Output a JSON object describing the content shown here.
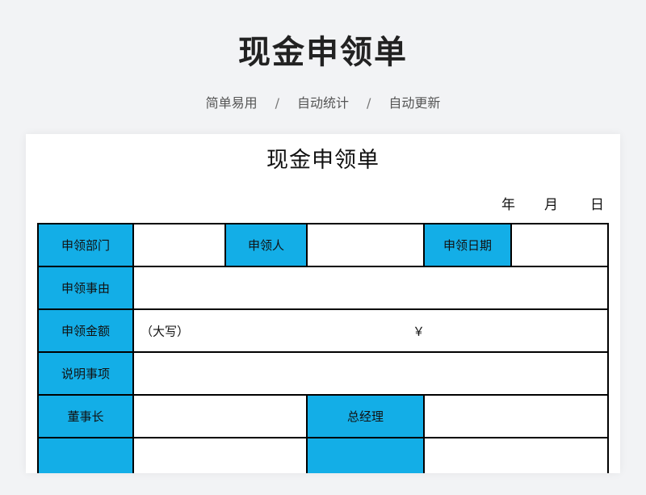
{
  "header": {
    "title": "现金申领单",
    "tags": [
      "简单易用",
      "自动统计",
      "自动更新"
    ],
    "separator": "/"
  },
  "document": {
    "title": "现金申领单",
    "date": {
      "year": "年",
      "month": "月",
      "day": "日"
    },
    "row1": {
      "dept_label": "申领部门",
      "person_label": "申领人",
      "date_label": "申领日期"
    },
    "reason_label": "申领事由",
    "amount": {
      "label": "申领金额",
      "caps_text": "（大写）",
      "yen": "￥"
    },
    "notes_label": "说明事项",
    "approval": {
      "chairman_label": "董事长",
      "gm_label": "总经理"
    }
  },
  "colors": {
    "label_bg": "#13aee7",
    "border": "#000000",
    "page_bg": "#f2f3f5"
  }
}
